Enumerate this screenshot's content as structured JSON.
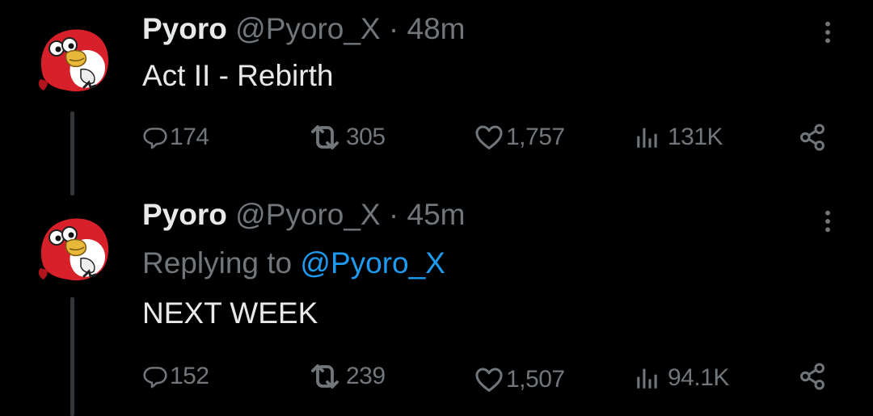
{
  "tweets": [
    {
      "name": "Pyoro",
      "handle": "@Pyoro_X",
      "dot": "·",
      "time": "48m",
      "text": "Act II - Rebirth",
      "replies": "174",
      "reposts": "305",
      "likes": "1,757",
      "views": "131K"
    },
    {
      "name": "Pyoro",
      "handle": "@Pyoro_X",
      "dot": "·",
      "time": "45m",
      "replying_prefix": "Replying to",
      "replying_to": "@Pyoro_X",
      "text": "NEXT WEEK",
      "replies": "152",
      "reposts": "239",
      "likes": "1,507",
      "views": "94.1K"
    }
  ],
  "icons": {
    "reply": "speech-bubble-icon",
    "repost": "repost-arrows-icon",
    "like": "heart-icon",
    "views": "bar-chart-icon",
    "share": "share-icon",
    "more": "vertical-ellipsis-icon"
  },
  "colors": {
    "background": "#000000",
    "primary_text": "#e7e9ea",
    "secondary_text": "#71767b",
    "link": "#1d9bf0",
    "avatar_red": "#d8202a"
  }
}
